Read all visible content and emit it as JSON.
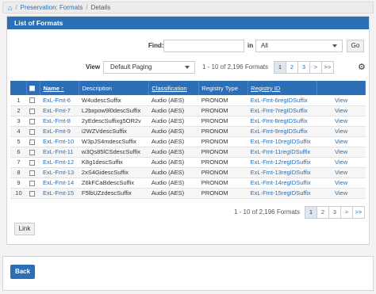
{
  "breadcrumb": {
    "home_icon": "home-icon",
    "items": [
      "Preservation: Formats",
      "Details"
    ],
    "separator": "/"
  },
  "panel": {
    "title": "List of Formats"
  },
  "search": {
    "find_label": "Find:",
    "find_value": "",
    "in_label": "in :",
    "in_selected": "All",
    "go_label": "Go"
  },
  "view": {
    "label": "View",
    "selected": "Default Paging",
    "count_text": "1 - 10 of 2,196 Formats"
  },
  "pager_top": [
    "1",
    "2",
    "3",
    ">",
    ">>"
  ],
  "gear_icon": "gear-icon",
  "table": {
    "headers": {
      "name": "Name ↑",
      "description": "Description",
      "classification": "Classification",
      "registry_type": "Registry Type",
      "registry_id": "Registry ID"
    },
    "rows": [
      {
        "num": "1",
        "name": "ExL-Fmt-6",
        "description": "W4udescSuffix",
        "classification": "Audio (AES)",
        "registry_type": "PRONOM",
        "registry_id": "ExL-Fmt-6regIDSuffix",
        "action": "View"
      },
      {
        "num": "2",
        "name": "ExL-Fmt-7",
        "description": "L2bxpow9l0descSuffix",
        "classification": "Audio (AES)",
        "registry_type": "PRONOM",
        "registry_id": "ExL-Fmt-7regIDSuffix",
        "action": "View"
      },
      {
        "num": "3",
        "name": "ExL-Fmt-8",
        "description": "2yEdescSuffixg5OR2v",
        "classification": "Audio (AES)",
        "registry_type": "PRONOM",
        "registry_id": "ExL-Fmt-8regIDSuffix",
        "action": "View"
      },
      {
        "num": "4",
        "name": "ExL-Fmt-9",
        "description": "i2WZVdescSuffix",
        "classification": "Audio (AES)",
        "registry_type": "PRONOM",
        "registry_id": "ExL-Fmt-9regIDSuffix",
        "action": "View"
      },
      {
        "num": "5",
        "name": "ExL-Fmt-10",
        "description": "W3pJS4mdescSuffix",
        "classification": "Audio (AES)",
        "registry_type": "PRONOM",
        "registry_id": "ExL-Fmt-10regIDSuffix",
        "action": "View"
      },
      {
        "num": "6",
        "name": "ExL-Fmt-11",
        "description": "w3Qs85lCSdescSuffix",
        "classification": "Audio (AES)",
        "registry_type": "PRONOM",
        "registry_id": "ExL-Fmt-11regIDSuffix",
        "action": "View"
      },
      {
        "num": "7",
        "name": "ExL-Fmt-12",
        "description": "K8g1descSuffix",
        "classification": "Audio (AES)",
        "registry_type": "PRONOM",
        "registry_id": "ExL-Fmt-12regIDSuffix",
        "action": "View"
      },
      {
        "num": "8",
        "name": "ExL-Fmt-13",
        "description": "2xS4GidescSuffix",
        "classification": "Audio (AES)",
        "registry_type": "PRONOM",
        "registry_id": "ExL-Fmt-13regIDSuffix",
        "action": "View"
      },
      {
        "num": "9",
        "name": "ExL-Fmt-14",
        "description": "Z6kFCaBdescSuffix",
        "classification": "Audio (AES)",
        "registry_type": "PRONOM",
        "registry_id": "ExL-Fmt-14regIDSuffix",
        "action": "View"
      },
      {
        "num": "10",
        "name": "ExL-Fmt-15",
        "description": "F5lbUZzdescSuffix",
        "classification": "Audio (AES)",
        "registry_type": "PRONOM",
        "registry_id": "ExL-Fmt-15regIDSuffix",
        "action": "View"
      }
    ]
  },
  "bottom": {
    "count_text": "1 - 10 of 2,196 Formats"
  },
  "pager_bottom": [
    "1",
    "2",
    "3",
    ">",
    ">>"
  ],
  "actions": {
    "link_label": "Link",
    "back_label": "Back"
  },
  "colors": {
    "primary": "#2d6fb6",
    "link": "#2a6db5"
  }
}
